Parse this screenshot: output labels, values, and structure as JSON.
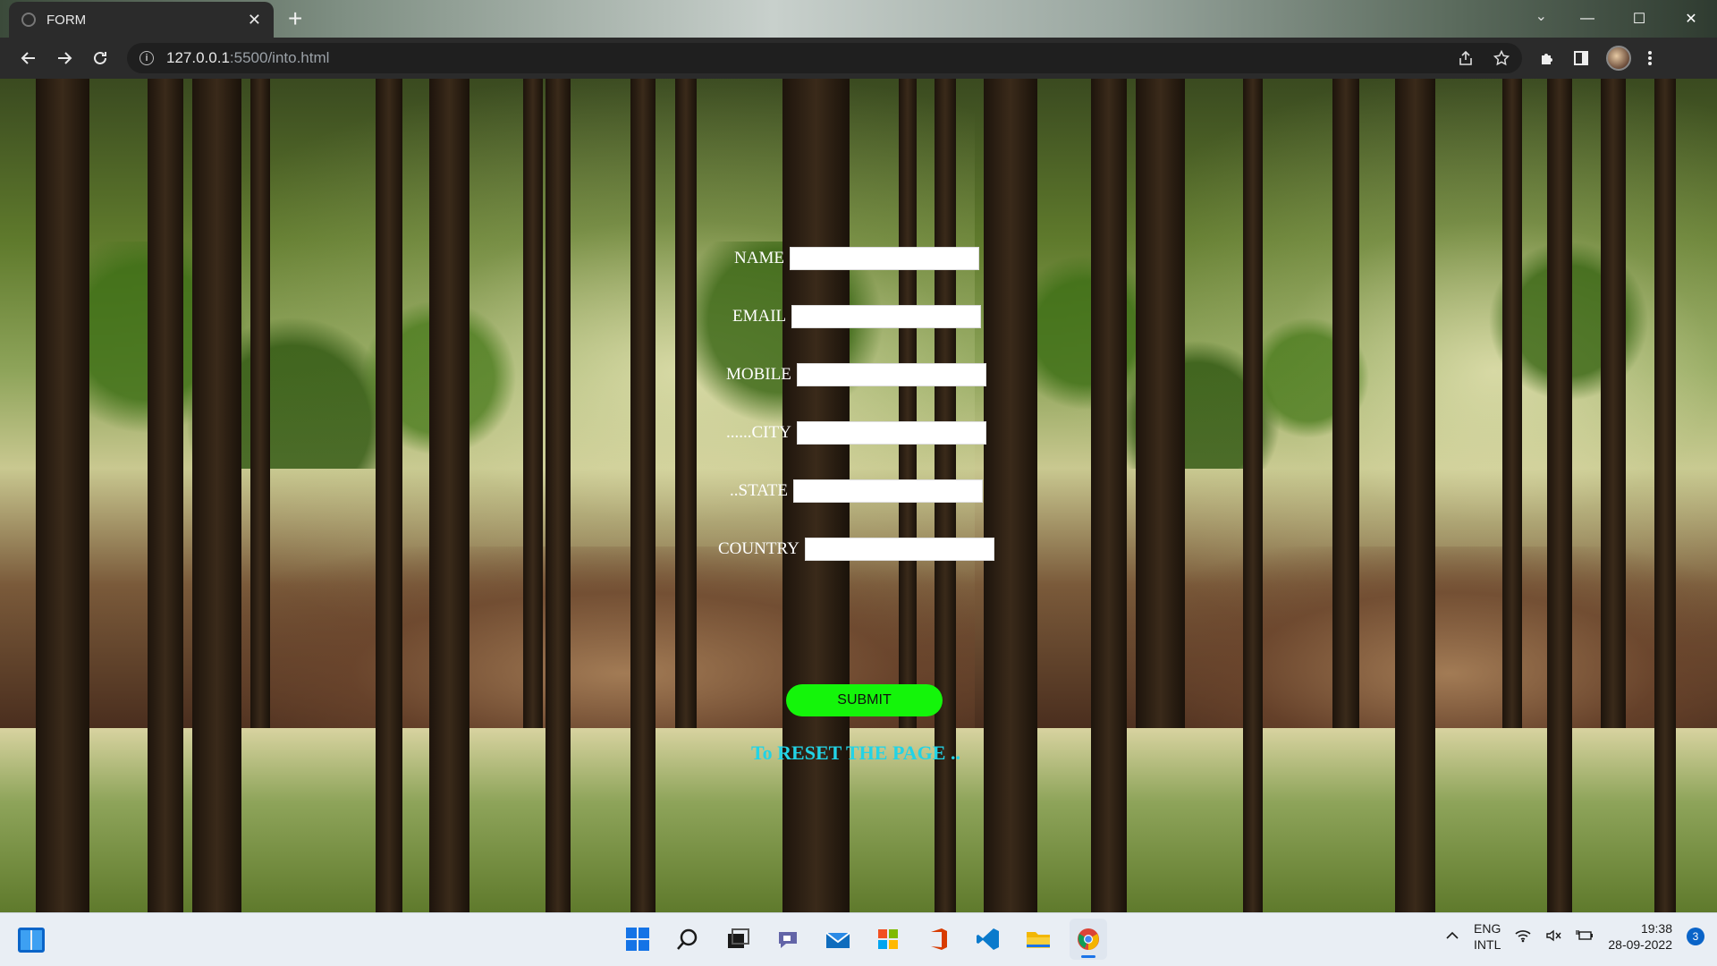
{
  "browser": {
    "tab_title": "FORM",
    "tab_close": "✕",
    "new_tab": "+",
    "url_host": "127.0.0.1",
    "url_path": ":5500/into.html"
  },
  "form": {
    "fields": [
      {
        "label": "NAME",
        "value": ""
      },
      {
        "label": "EMAIL",
        "value": ""
      },
      {
        "label": "MOBILE",
        "value": ""
      },
      {
        "label": "......CITY",
        "value": ""
      },
      {
        "label": "..STATE",
        "value": ""
      },
      {
        "label": "COUNTRY",
        "value": ""
      }
    ],
    "submit_label": "SUBMIT",
    "reset_text": "To RESET THE PAGE .."
  },
  "taskbar": {
    "lang_line1": "ENG",
    "lang_line2": "INTL",
    "time": "19:38",
    "date": "28-09-2022",
    "notification_count": "3"
  },
  "colors": {
    "submit_bg": "#14f50a",
    "reset_text": "#22d3e6"
  },
  "icons": [
    "windows-start-icon",
    "search-icon",
    "task-view-icon",
    "chat-icon",
    "mail-icon",
    "store-icon",
    "office-icon",
    "vscode-icon",
    "file-explorer-icon",
    "chrome-icon"
  ]
}
